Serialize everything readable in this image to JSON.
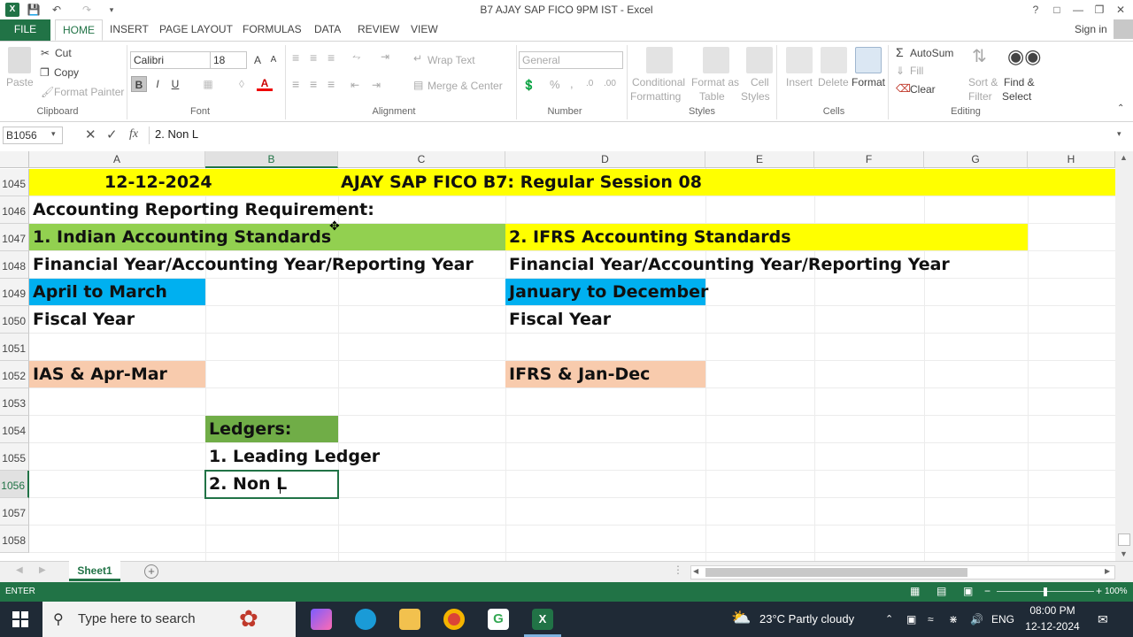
{
  "window": {
    "title": "B7 AJAY SAP FICO 9PM IST - Excel",
    "help": "?",
    "sign_in": "Sign in"
  },
  "ribbon_tabs": [
    "FILE",
    "HOME",
    "INSERT",
    "PAGE LAYOUT",
    "FORMULAS",
    "DATA",
    "REVIEW",
    "VIEW"
  ],
  "ribbon": {
    "clipboard": {
      "paste": "Paste",
      "cut": "Cut",
      "copy": "Copy",
      "format_painter": "Format Painter",
      "label": "Clipboard"
    },
    "font": {
      "name": "Calibri",
      "size": "18",
      "bold": "B",
      "italic": "I",
      "underline": "U",
      "label": "Font"
    },
    "alignment": {
      "wrap_text": "Wrap Text",
      "merge_center": "Merge & Center",
      "label": "Alignment"
    },
    "number": {
      "format": "General",
      "percent": "%",
      "comma": ",",
      "label": "Number"
    },
    "styles": {
      "conditional": "Conditional",
      "formatting": "Formatting",
      "format_as": "Format as",
      "table": "Table",
      "cell": "Cell",
      "styles": "Styles",
      "label": "Styles"
    },
    "cells": {
      "insert": "Insert",
      "delete": "Delete",
      "format": "Format",
      "label": "Cells"
    },
    "editing": {
      "autosum": "AutoSum",
      "fill": "Fill",
      "clear": "Clear",
      "sort": "Sort &",
      "filter": "Filter",
      "find": "Find &",
      "select": "Select",
      "label": "Editing"
    }
  },
  "formula_bar": {
    "name_box": "B1056",
    "fx": "fx",
    "content": "2. Non L"
  },
  "columns": [
    "A",
    "B",
    "C",
    "D",
    "E",
    "F",
    "G",
    "H"
  ],
  "rows": [
    "1045",
    "1046",
    "1047",
    "1048",
    "1049",
    "1050",
    "1051",
    "1052",
    "1053",
    "1054",
    "1055",
    "1056",
    "1057",
    "1058"
  ],
  "cells": {
    "a1045": "12-12-2024",
    "c1045": "AJAY SAP FICO B7: Regular Session 08",
    "a1046": "Accounting Reporting Requirement:",
    "a1047": "1. Indian Accounting Standards",
    "d1047": "2. IFRS Accounting Standards",
    "a1048": "Financial Year/Accounting Year/Reporting Year",
    "d1048": "Financial Year/Accounting Year/Reporting Year",
    "a1049": "April to March",
    "d1049": "January to December",
    "a1050": "Fiscal Year",
    "d1050": "Fiscal Year",
    "a1052": "IAS & Apr-Mar",
    "d1052": "IFRS & Jan-Dec",
    "b1054": "Ledgers:",
    "b1055": "1. Leading Ledger",
    "b1056": "2. Non L"
  },
  "colors": {
    "excel_green": "#217346",
    "yellow": "#FFFF00",
    "green_fill": "#92D050",
    "blue_fill": "#00B0F0",
    "peach_fill": "#F8CBAD",
    "ledger_green": "#70AD47"
  },
  "sheet_tab": "Sheet1",
  "status": {
    "mode": "ENTER",
    "zoom": "100%"
  },
  "taskbar": {
    "search_placeholder": "Type here to search",
    "weather": "23°C  Partly cloudy",
    "lang": "ENG",
    "time": "08:00 PM",
    "date": "12-12-2024"
  }
}
